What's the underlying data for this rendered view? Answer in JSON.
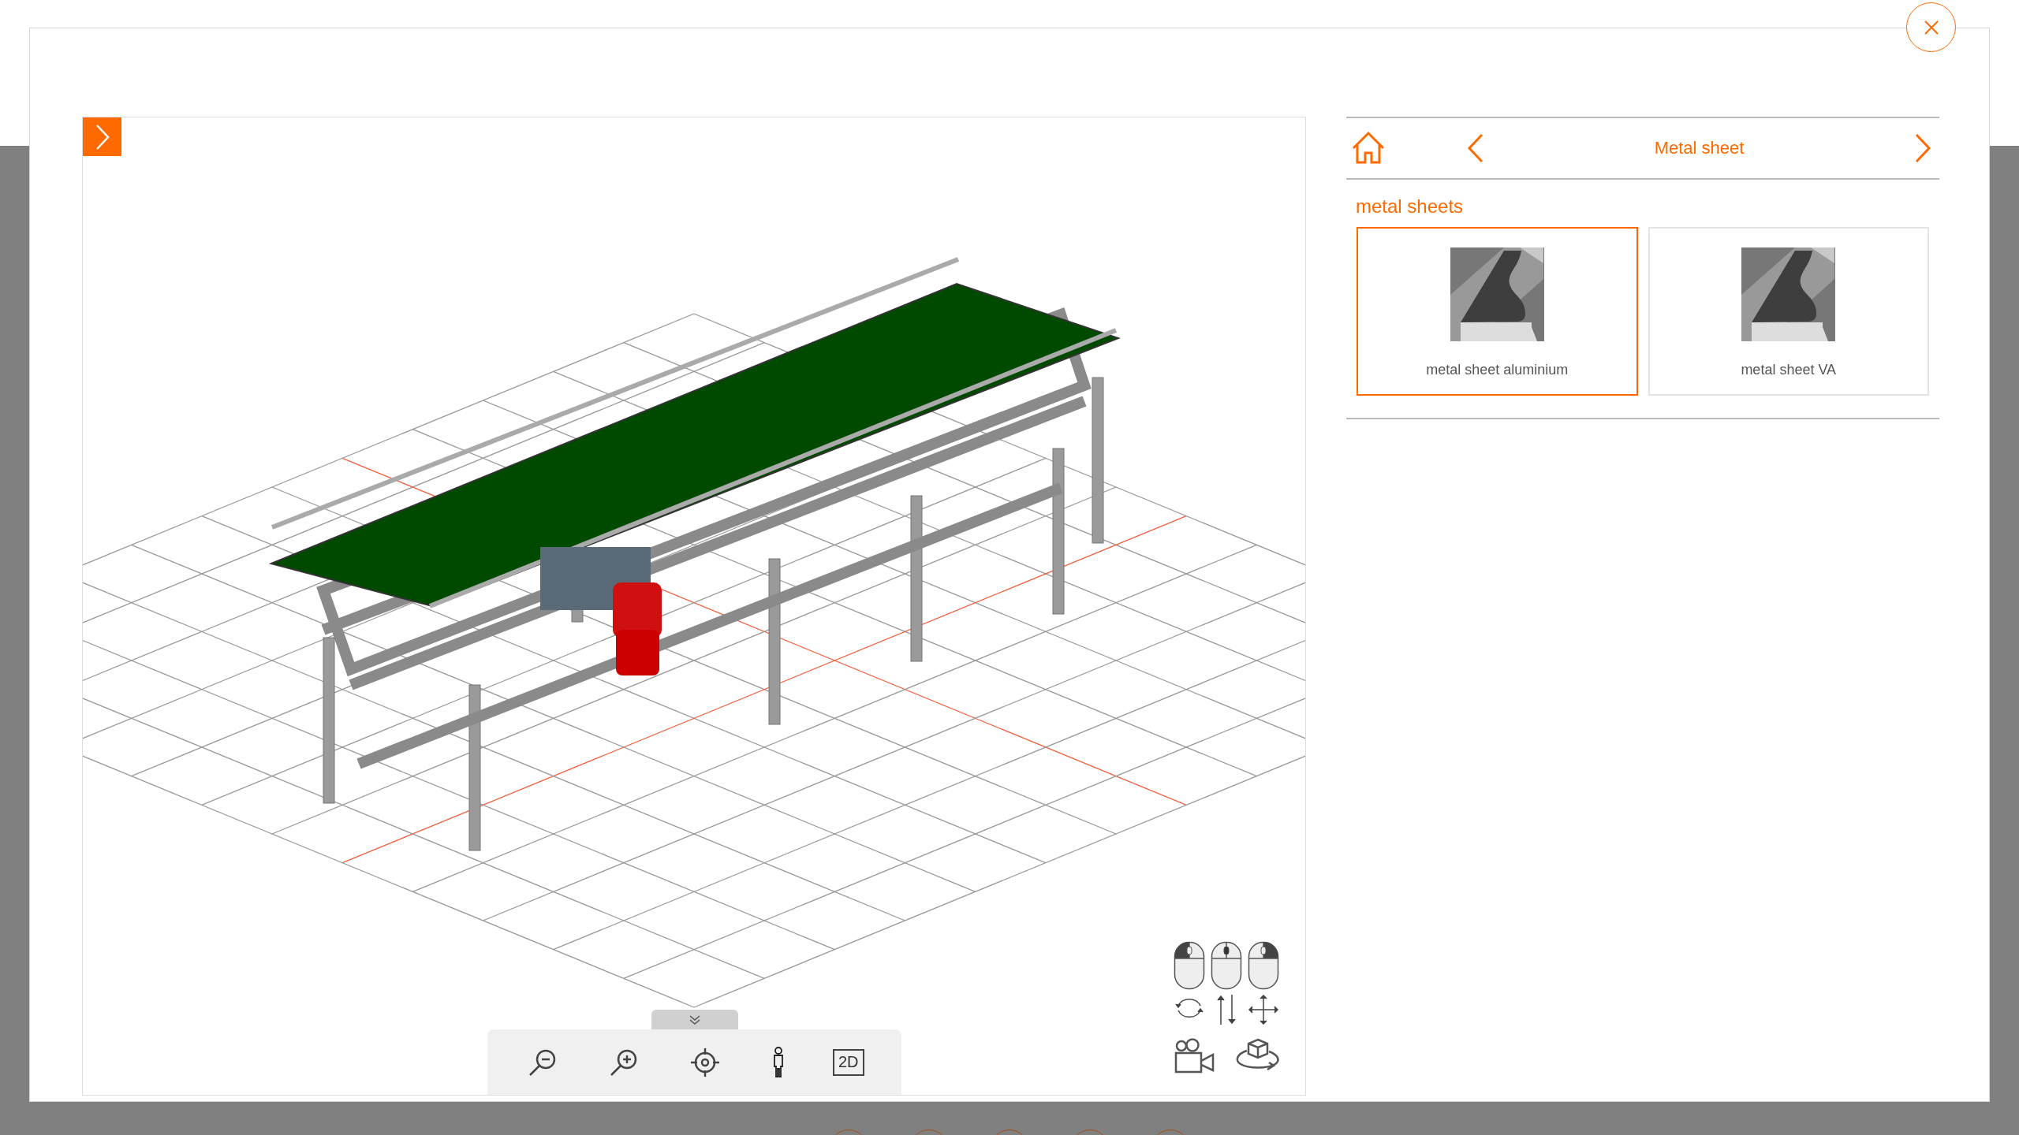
{
  "navigator": {
    "title": "Metal sheet"
  },
  "section": {
    "title": "metal sheets"
  },
  "options": [
    {
      "label": "metal sheet aluminium",
      "selected": true
    },
    {
      "label": "metal sheet VA",
      "selected": false
    }
  ],
  "tools": [
    {
      "kind": "zoom-out"
    },
    {
      "kind": "zoom-in"
    },
    {
      "kind": "center"
    },
    {
      "kind": "person"
    },
    {
      "kind": "view-2d",
      "label": "2D"
    }
  ]
}
